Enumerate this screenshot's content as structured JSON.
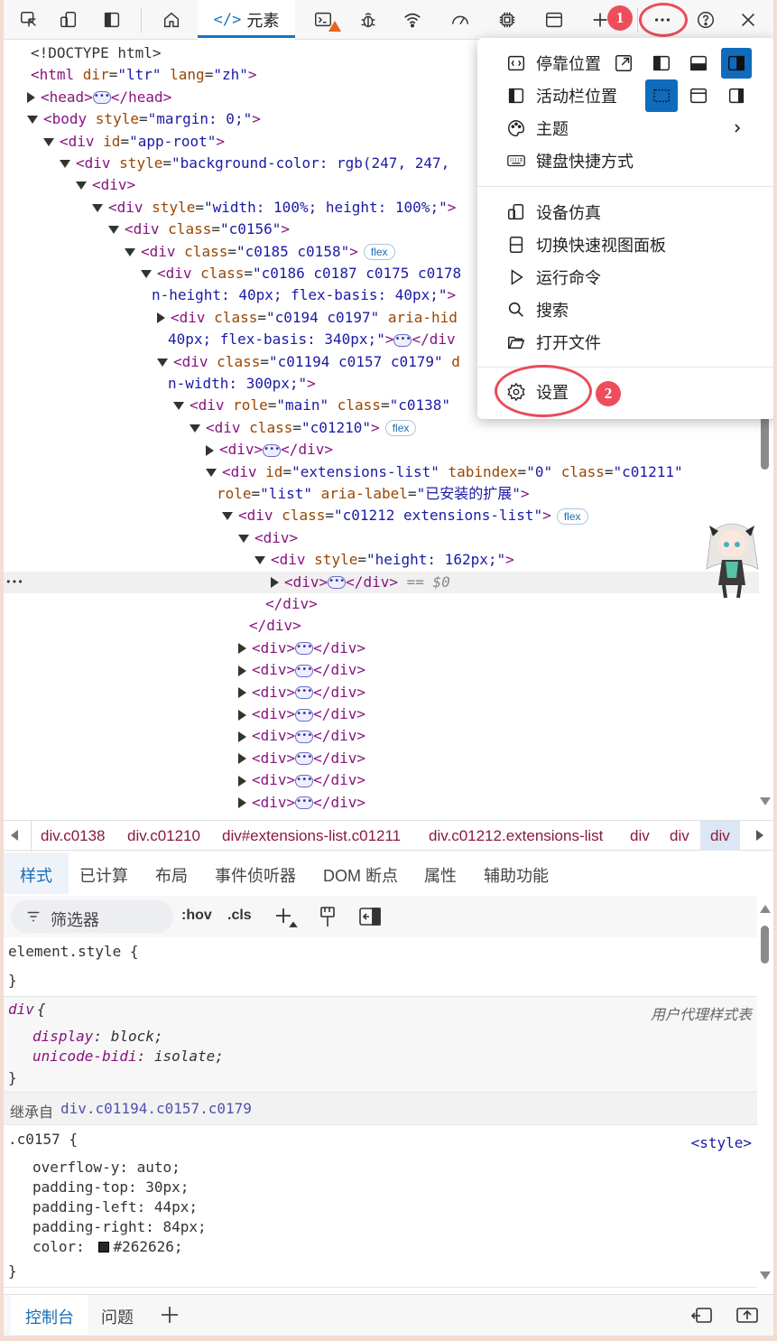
{
  "toolbar": {
    "tab_elements": "元素",
    "badge_1": "1",
    "badge_2": "2"
  },
  "dom": {
    "lines": [
      {
        "indent": 0,
        "t": "none",
        "parts": [
          [
            "pl",
            "<!DOCTYPE html>"
          ]
        ]
      },
      {
        "indent": 0,
        "t": "none",
        "parts": [
          [
            "tg",
            "<html "
          ],
          [
            "an",
            "dir"
          ],
          [
            "pl",
            "="
          ],
          [
            "av",
            "\"ltr\""
          ],
          [
            "an",
            " lang"
          ],
          [
            "pl",
            "="
          ],
          [
            "av",
            "\"zh\""
          ],
          [
            "tg",
            ">"
          ]
        ]
      },
      {
        "indent": 0,
        "t": "closed",
        "parts": [
          [
            "tg",
            "<head>"
          ],
          [
            "ell",
            ""
          ],
          [
            "tg",
            "</head>"
          ]
        ]
      },
      {
        "indent": 0,
        "t": "open",
        "parts": [
          [
            "tg",
            "<body "
          ],
          [
            "an",
            "style"
          ],
          [
            "pl",
            "="
          ],
          [
            "av",
            "\"margin: 0;\""
          ],
          [
            "tg",
            ">"
          ]
        ]
      },
      {
        "indent": 1,
        "t": "open",
        "parts": [
          [
            "tg",
            "<div "
          ],
          [
            "an",
            "id"
          ],
          [
            "pl",
            "="
          ],
          [
            "av",
            "\"app-root\""
          ],
          [
            "tg",
            ">"
          ]
        ]
      },
      {
        "indent": 2,
        "t": "open",
        "parts": [
          [
            "tg",
            "<div "
          ],
          [
            "an",
            "style"
          ],
          [
            "pl",
            "="
          ],
          [
            "av",
            "\"background-color: rgb(247, 247, "
          ]
        ]
      },
      {
        "indent": 3,
        "t": "open",
        "parts": [
          [
            "tg",
            "<div>"
          ]
        ]
      },
      {
        "indent": 4,
        "t": "open",
        "parts": [
          [
            "tg",
            "<div "
          ],
          [
            "an",
            "style"
          ],
          [
            "pl",
            "="
          ],
          [
            "av",
            "\"width: 100%; height: 100%;\""
          ],
          [
            "tg",
            ">"
          ]
        ]
      },
      {
        "indent": 5,
        "t": "open",
        "parts": [
          [
            "tg",
            "<div "
          ],
          [
            "an",
            "class"
          ],
          [
            "pl",
            "="
          ],
          [
            "av",
            "\"c0156\""
          ],
          [
            "tg",
            ">"
          ]
        ]
      },
      {
        "indent": 6,
        "t": "open",
        "parts": [
          [
            "tg",
            "<div "
          ],
          [
            "an",
            "class"
          ],
          [
            "pl",
            "="
          ],
          [
            "av",
            "\"c0185 c0158\""
          ],
          [
            "tg",
            ">"
          ],
          [
            "flx",
            "flex"
          ]
        ]
      },
      {
        "indent": 7,
        "t": "open",
        "parts": [
          [
            "tg",
            "<div "
          ],
          [
            "an",
            "class"
          ],
          [
            "pl",
            "="
          ],
          [
            "av",
            "\"c0186 c0187 c0175 c0178"
          ]
        ]
      },
      {
        "indent": 7,
        "t": "cont",
        "parts": [
          [
            "av",
            "n-height: 40px; flex-basis: 40px;\""
          ],
          [
            "tg",
            ">"
          ]
        ]
      },
      {
        "indent": 8,
        "t": "closed",
        "parts": [
          [
            "tg",
            "<div "
          ],
          [
            "an",
            "class"
          ],
          [
            "pl",
            "="
          ],
          [
            "av",
            "\"c0194 c0197\""
          ],
          [
            "an",
            " aria-hid"
          ]
        ]
      },
      {
        "indent": 8,
        "t": "cont",
        "parts": [
          [
            "av",
            "40px; flex-basis: 340px;\""
          ],
          [
            "tg",
            ">"
          ],
          [
            "ell",
            ""
          ],
          [
            "tg",
            "</div"
          ]
        ]
      },
      {
        "indent": 8,
        "t": "open",
        "parts": [
          [
            "tg",
            "<div "
          ],
          [
            "an",
            "class"
          ],
          [
            "pl",
            "="
          ],
          [
            "av",
            "\"c01194 c0157 c0179\""
          ],
          [
            "an",
            " d"
          ]
        ]
      },
      {
        "indent": 8,
        "t": "cont",
        "parts": [
          [
            "av",
            "n-width: 300px;\""
          ],
          [
            "tg",
            ">"
          ]
        ]
      },
      {
        "indent": 9,
        "t": "open",
        "parts": [
          [
            "tg",
            "<div "
          ],
          [
            "an",
            "role"
          ],
          [
            "pl",
            "="
          ],
          [
            "av",
            "\"main\""
          ],
          [
            "an",
            " class"
          ],
          [
            "pl",
            "="
          ],
          [
            "av",
            "\"c0138\""
          ]
        ]
      },
      {
        "indent": 10,
        "t": "open",
        "parts": [
          [
            "tg",
            "<div "
          ],
          [
            "an",
            "class"
          ],
          [
            "pl",
            "="
          ],
          [
            "av",
            "\"c01210\""
          ],
          [
            "tg",
            ">"
          ],
          [
            "flx",
            "flex"
          ]
        ]
      },
      {
        "indent": 11,
        "t": "closed",
        "parts": [
          [
            "tg",
            "<div>"
          ],
          [
            "ell",
            ""
          ],
          [
            "tg",
            "</div>"
          ]
        ]
      },
      {
        "indent": 11,
        "t": "open",
        "parts": [
          [
            "tg",
            "<div "
          ],
          [
            "an",
            "id"
          ],
          [
            "pl",
            "="
          ],
          [
            "av",
            "\"extensions-list\""
          ],
          [
            "an",
            " tabindex"
          ],
          [
            "pl",
            "="
          ],
          [
            "av",
            "\"0\""
          ],
          [
            "an",
            " class"
          ],
          [
            "pl",
            "="
          ],
          [
            "av",
            "\"c01211\""
          ]
        ]
      },
      {
        "indent": 11,
        "t": "cont",
        "parts": [
          [
            "an",
            "role"
          ],
          [
            "pl",
            "="
          ],
          [
            "av",
            "\"list\""
          ],
          [
            "an",
            " aria-label"
          ],
          [
            "pl",
            "="
          ],
          [
            "av",
            "\"已安装的扩展\""
          ],
          [
            "tg",
            ">"
          ]
        ]
      },
      {
        "indent": 12,
        "t": "open",
        "parts": [
          [
            "tg",
            "<div "
          ],
          [
            "an",
            "class"
          ],
          [
            "pl",
            "="
          ],
          [
            "av",
            "\"c01212 extensions-list\""
          ],
          [
            "tg",
            ">"
          ],
          [
            "flx",
            "flex"
          ]
        ]
      },
      {
        "indent": 13,
        "t": "open",
        "parts": [
          [
            "tg",
            "<div>"
          ]
        ]
      },
      {
        "indent": 14,
        "t": "open",
        "parts": [
          [
            "tg",
            "<div "
          ],
          [
            "an",
            "style"
          ],
          [
            "pl",
            "="
          ],
          [
            "av",
            "\"height: 162px;\""
          ],
          [
            "tg",
            ">"
          ]
        ]
      },
      {
        "indent": 15,
        "t": "closed",
        "sel": true,
        "parts": [
          [
            "tg",
            "<div>"
          ],
          [
            "ell",
            ""
          ],
          [
            "tg",
            "</div>"
          ],
          [
            "eq",
            " == $0"
          ]
        ]
      },
      {
        "indent": 14,
        "t": "cont",
        "parts": [
          [
            "tg",
            "</div>"
          ]
        ]
      },
      {
        "indent": 13,
        "t": "cont",
        "parts": [
          [
            "tg",
            "</div>"
          ]
        ]
      },
      {
        "indent": 13,
        "t": "closed",
        "parts": [
          [
            "tg",
            "<div>"
          ],
          [
            "ell",
            ""
          ],
          [
            "tg",
            "</div>"
          ]
        ]
      },
      {
        "indent": 13,
        "t": "closed",
        "parts": [
          [
            "tg",
            "<div>"
          ],
          [
            "ell",
            ""
          ],
          [
            "tg",
            "</div>"
          ]
        ]
      },
      {
        "indent": 13,
        "t": "closed",
        "parts": [
          [
            "tg",
            "<div>"
          ],
          [
            "ell",
            ""
          ],
          [
            "tg",
            "</div>"
          ]
        ]
      },
      {
        "indent": 13,
        "t": "closed",
        "parts": [
          [
            "tg",
            "<div>"
          ],
          [
            "ell",
            ""
          ],
          [
            "tg",
            "</div>"
          ]
        ]
      },
      {
        "indent": 13,
        "t": "closed",
        "parts": [
          [
            "tg",
            "<div>"
          ],
          [
            "ell",
            ""
          ],
          [
            "tg",
            "</div>"
          ]
        ]
      },
      {
        "indent": 13,
        "t": "closed",
        "parts": [
          [
            "tg",
            "<div>"
          ],
          [
            "ell",
            ""
          ],
          [
            "tg",
            "</div>"
          ]
        ]
      },
      {
        "indent": 13,
        "t": "closed",
        "parts": [
          [
            "tg",
            "<div>"
          ],
          [
            "ell",
            ""
          ],
          [
            "tg",
            "</div>"
          ]
        ]
      },
      {
        "indent": 13,
        "t": "closed",
        "parts": [
          [
            "tg",
            "<div>"
          ],
          [
            "ell",
            ""
          ],
          [
            "tg",
            "</div>"
          ]
        ]
      }
    ]
  },
  "breadcrumb": [
    "div.c0138",
    "div.c01210",
    "div#extensions-list.c01211",
    "div.c01212.extensions-list",
    "div",
    "div",
    "div"
  ],
  "subtabs": [
    "样式",
    "已计算",
    "布局",
    "事件侦听器",
    "DOM 断点",
    "属性",
    "辅助功能"
  ],
  "filter": {
    "placeholder": "筛选器",
    "hov": ":hov",
    "cls": ".cls"
  },
  "styles": {
    "element_style": "element.style {",
    "close_brace": "}",
    "div_selector": "div",
    "open_brace": " {",
    "ua_label": "用户代理样式表",
    "div_props": [
      [
        "display",
        "block;"
      ],
      [
        "unicode-bidi",
        "isolate;"
      ]
    ],
    "inherited_label": "继承自",
    "inherited_from": "div.c01194.c0157.c0179",
    "c0157_selector": ".c0157 {",
    "c0157_source": "<style>",
    "c0157_props": [
      [
        "overflow-y",
        "auto;"
      ],
      [
        "padding-top",
        "30px;"
      ],
      [
        "padding-left",
        "44px;"
      ],
      [
        "padding-right",
        "84px;"
      ],
      [
        "color",
        "#262626;"
      ]
    ],
    "swatch_color": "#262626"
  },
  "bottom": {
    "console": "控制台",
    "issues": "问题"
  },
  "menu": {
    "dock_label": "停靠位置",
    "activity_label": "活动栏位置",
    "theme": "主题",
    "shortcuts": "键盘快捷方式",
    "device": "设备仿真",
    "quickview": "切换快速视图面板",
    "run": "运行命令",
    "search": "搜索",
    "open_file": "打开文件",
    "settings": "设置"
  },
  "colors": {
    "accent": "#0f6cbd",
    "highlight_ring": "#ea4b5d"
  }
}
